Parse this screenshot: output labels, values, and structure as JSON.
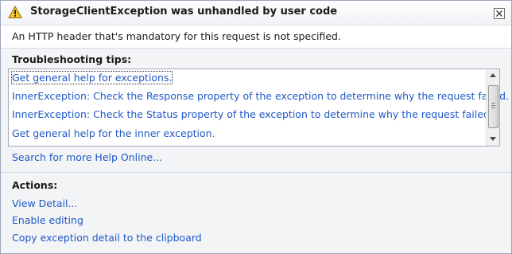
{
  "dialog": {
    "title": "StorageClientException was unhandled by user code",
    "message": "An HTTP header that's mandatory for this request is not specified.",
    "icons": {
      "warning": "warning-icon",
      "close": "close-icon"
    }
  },
  "troubleshooting": {
    "heading": "Troubleshooting tips:",
    "tips": [
      "Get general help for exceptions.",
      "InnerException: Check the Response property of the exception to determine why the request failed.",
      "InnerException: Check the Status property of the exception to determine why the request failed.",
      "Get general help for the inner exception."
    ],
    "search_link": "Search for more Help Online..."
  },
  "actions": {
    "heading": "Actions:",
    "items": [
      "View Detail...",
      "Enable editing",
      "Copy exception detail to the clipboard"
    ]
  },
  "colors": {
    "link": "#1f58c7",
    "warning_fill": "#f7c52e",
    "border": "#9aa6b8"
  }
}
